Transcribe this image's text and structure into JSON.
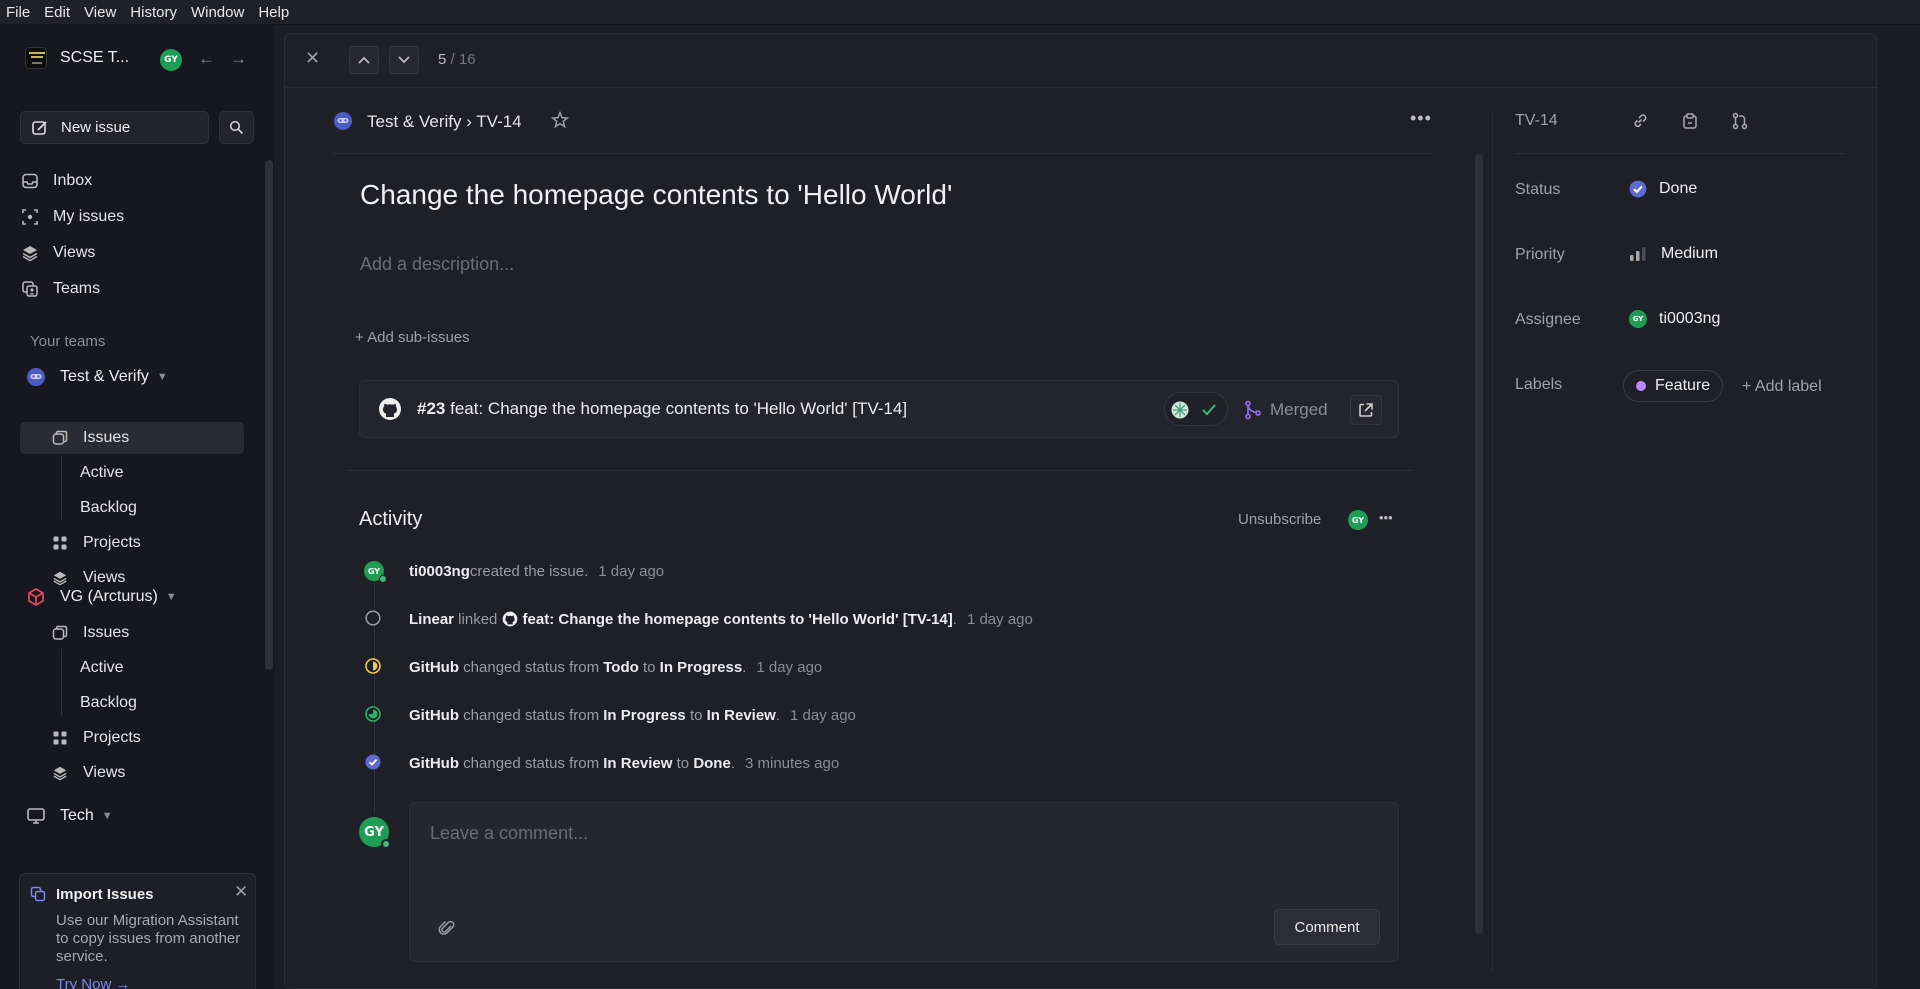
{
  "menubar": [
    "File",
    "Edit",
    "View",
    "History",
    "Window",
    "Help"
  ],
  "workspace": {
    "name": "SCSE T...",
    "avatar": "GY"
  },
  "sidebar": {
    "new_issue": "New issue",
    "nav": [
      "Inbox",
      "My issues",
      "Views",
      "Teams"
    ],
    "your_teams": "Your teams",
    "team1": {
      "name": "Test & Verify",
      "items": [
        "Issues",
        "Active",
        "Backlog",
        "Projects",
        "Views"
      ]
    },
    "team2": {
      "name": "VG (Arcturus)",
      "items": [
        "Issues",
        "Active",
        "Backlog",
        "Projects",
        "Views"
      ]
    },
    "team3": {
      "name": "Tech"
    },
    "import": {
      "title": "Import Issues",
      "body": "Use our Migration Assistant to copy issues from another service.",
      "cta": "Try Now →"
    }
  },
  "topbar": {
    "position": "5",
    "total": "/ 16"
  },
  "issue": {
    "breadcrumb": "Test & Verify › TV-14",
    "title": "Change the homepage contents to 'Hello World'",
    "description_placeholder": "Add a description...",
    "add_sub_issues": "+ Add sub-issues",
    "pr": {
      "number": "#23",
      "title": "feat: Change the homepage contents to 'Hello World' [TV-14]",
      "state": "Merged"
    }
  },
  "activity": {
    "title": "Activity",
    "unsubscribe": "Unsubscribe",
    "events": [
      {
        "actor": "ti0003ng",
        "parts": [
          " created the issue."
        ],
        "time": "1 day ago"
      },
      {
        "actor": "Linear",
        "parts": [
          " linked "
        ],
        "link": "feat: Change the homepage contents to 'Hello World' [TV-14]",
        "tail": ".",
        "time": "1 day ago"
      },
      {
        "actor": "GitHub",
        "text": " changed status from ",
        "from": "Todo",
        "to_word": " to ",
        "to": "In Progress",
        "time": "1 day ago"
      },
      {
        "actor": "GitHub",
        "text": " changed status from ",
        "from": "In Progress",
        "to_word": " to ",
        "to": "In Review",
        "time": "1 day ago"
      },
      {
        "actor": "GitHub",
        "text": " changed status from ",
        "from": "In Review",
        "to_word": " to ",
        "to": "Done",
        "time": "3 minutes ago"
      }
    ],
    "comment_placeholder": "Leave a comment...",
    "comment_button": "Comment"
  },
  "properties": {
    "id": "TV-14",
    "status_label": "Status",
    "status": "Done",
    "priority_label": "Priority",
    "priority": "Medium",
    "assignee_label": "Assignee",
    "assignee": "ti0003ng",
    "labels_label": "Labels",
    "label": "Feature",
    "add_label": "+ Add label"
  },
  "colors": {
    "accent": "#5e6ad2",
    "done": "#5e6ad2",
    "in_progress": "#f2c94c",
    "in_review": "#26b565",
    "feature": "#bb87fc",
    "avatar": "#1f9d55"
  }
}
